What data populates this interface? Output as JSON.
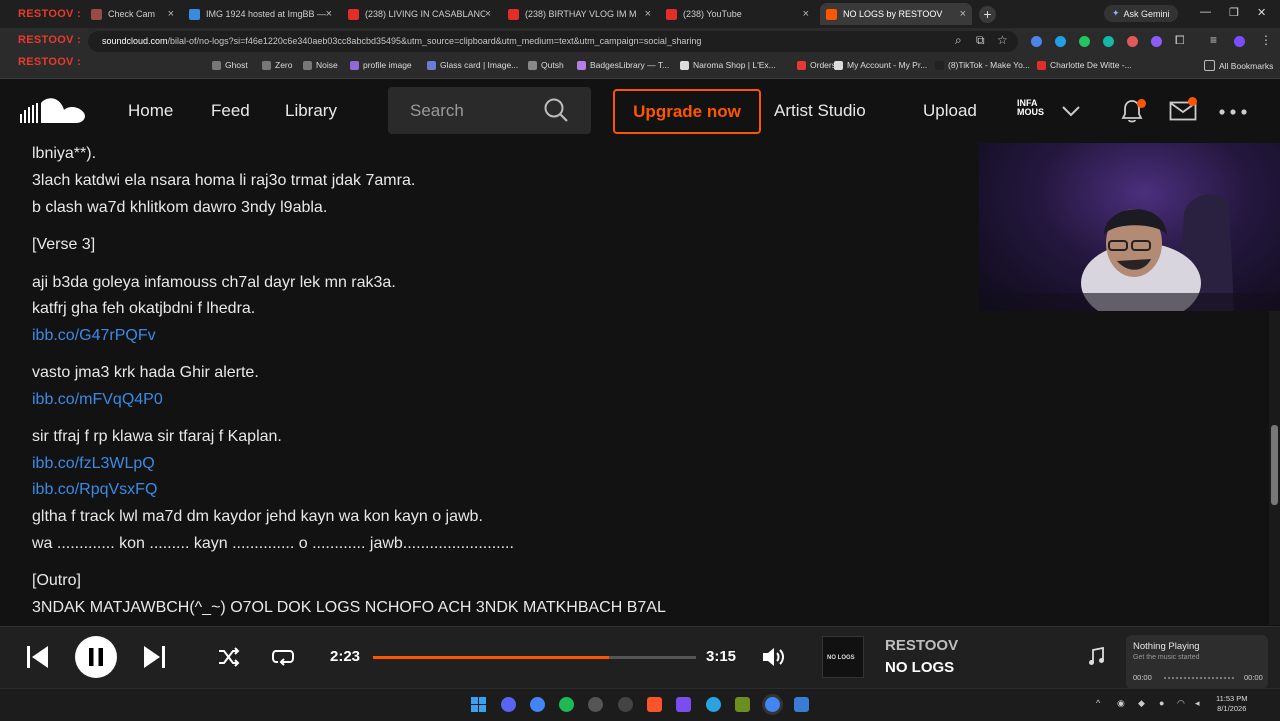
{
  "browser": {
    "tabs": [
      {
        "title": "Check Cam",
        "favicon_color": "#9b4a4a",
        "active": false
      },
      {
        "title": "IMG 1924 hosted at ImgBB —",
        "favicon_color": "#3a8be0",
        "active": false
      },
      {
        "title": "(238) LIVING IN CASABLANCA",
        "favicon_color": "#e52d27",
        "active": false
      },
      {
        "title": "(238) BIRTHAY VLOG IM M",
        "favicon_color": "#e52d27",
        "active": false
      },
      {
        "title": "(238) YouTube",
        "favicon_color": "#e52d27",
        "active": false
      },
      {
        "title": "NO LOGS by RESTOOV",
        "favicon_color": "#ff5500",
        "active": true
      }
    ],
    "ask_gemini": "Ask Gemini",
    "url_prefix": "",
    "url_domain": "soundcloud.com",
    "url_rest": "/bilal-of/no-logs?si=f46e1220c6e340aeb03cc8abcbd35495&utm_source=clipboard&utm_medium=text&utm_campaign=social_sharing",
    "overlay_text": "RESTOOV :",
    "bookmarks": [
      {
        "label": "Ghost",
        "color": "#777777"
      },
      {
        "label": "Zero",
        "color": "#777777"
      },
      {
        "label": "Noise",
        "color": "#777777"
      },
      {
        "label": "profile image",
        "color": "#8f6ad6"
      },
      {
        "label": "Glass card | Image...",
        "color": "#6b7bd6"
      },
      {
        "label": "Qutsh",
        "color": "#888888"
      },
      {
        "label": "BadgesLibrary — T...",
        "color": "#b57ee6"
      },
      {
        "label": "Naroma Shop | L'Ex...",
        "color": "#dddddd"
      },
      {
        "label": "Orders",
        "color": "#e53935"
      },
      {
        "label": "My Account - My Pr...",
        "color": "#dddddd"
      },
      {
        "label": "(8)TikTok - Make Yo...",
        "color": "#222222"
      },
      {
        "label": "Charlotte De Witte -...",
        "color": "#e52d27"
      }
    ],
    "all_bookmarks": "All Bookmarks"
  },
  "header": {
    "nav": {
      "home": "Home",
      "feed": "Feed",
      "library": "Library"
    },
    "search_placeholder": "Search",
    "upgrade": "Upgrade now",
    "artist_studio": "Artist Studio",
    "upload": "Upload",
    "avatar_text": "INFA MOUS"
  },
  "lyrics": [
    {
      "text": "lbniya**).",
      "link": false
    },
    {
      "text": "3lach katdwi ela nsara homa li raj3o trmat jdak 7amra.",
      "link": false
    },
    {
      "text": "b clash wa7d khlitkom dawro 3ndy l9abla.",
      "link": false
    },
    {
      "text": "[Verse 3]",
      "link": false
    },
    {
      "text": "aji b3da goleya infamouss ch7al dayr lek mn rak3a.",
      "link": false
    },
    {
      "text": "katfrj gha feh okatjbdni f lhedra.",
      "link": false
    },
    {
      "text": "ibb.co/G47rPQFv",
      "link": true
    },
    {
      "text": "vasto jma3 krk hada Ghir alerte.",
      "link": false
    },
    {
      "text": "ibb.co/mFVqQ4P0",
      "link": true
    },
    {
      "text": "sir tfraj f rp klawa sir tfaraj f Kaplan.",
      "link": false
    },
    {
      "text": "ibb.co/fzL3WLpQ",
      "link": true
    },
    {
      "text": "ibb.co/RpqVsxFQ",
      "link": true
    },
    {
      "text": "gltha f track lwl ma7d dm kaydor jehd kayn wa kon kayn o jawb.",
      "link": false
    },
    {
      "text": "wa ............. kon ......... kayn .............. o ............ jawb.........................",
      "link": false
    },
    {
      "text": "[Outro]",
      "link": false
    },
    {
      "text": "3NDAK MATJAWBCH(^_~) O7OL DOK LOGS NCHOFO ACH 3NDK MATKHBACH B7AL",
      "link": false
    }
  ],
  "player": {
    "current_time": "2:23",
    "duration": "3:15",
    "progress": 0.73,
    "artist": "RESTOOV",
    "title": "NO LOGS",
    "art_text": "NO LOGS"
  },
  "now_playing_widget": {
    "title": "Nothing Playing",
    "subtitle": "Get the music started",
    "time_start": "00:00",
    "time_end": "00:00"
  },
  "taskbar": {
    "time": "11:53 PM",
    "date": "8/1/2026"
  },
  "colors": {
    "accent": "#ff5500",
    "link": "#3b8ae6"
  }
}
